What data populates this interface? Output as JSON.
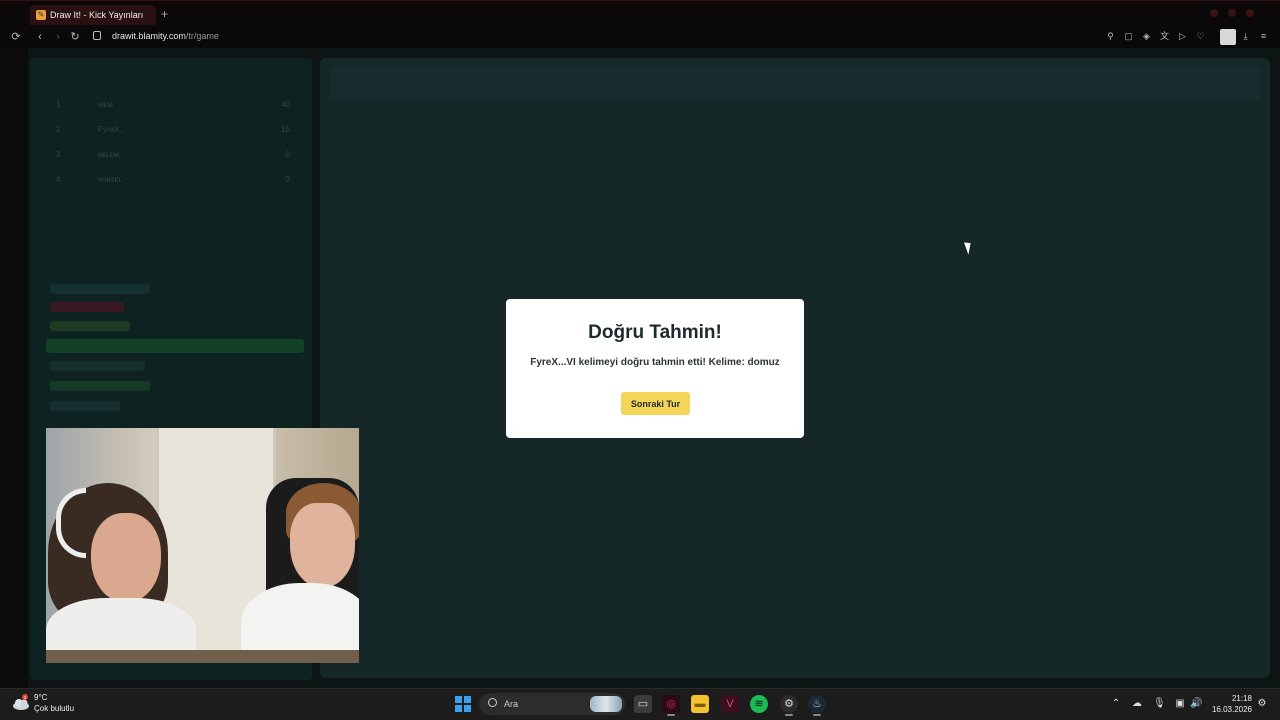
{
  "browser": {
    "tab_title": "Draw It! - Kick Yayınları",
    "new_tab_symbol": "+",
    "url_domain": "drawit.blamity.com",
    "url_path": "/tr/game"
  },
  "leaderboard": [
    {
      "rank": "1",
      "name": "ᴍᴇᴍ",
      "score": "40"
    },
    {
      "rank": "2",
      "name": "FyreX...",
      "score": "15"
    },
    {
      "rank": "3",
      "name": "ʙᴇʟᴇᴍ",
      "score": "0"
    },
    {
      "rank": "4",
      "name": "ʏᴜᴋsᴇʟ",
      "score": "0"
    }
  ],
  "modal": {
    "title": "Doğru Tahmin!",
    "message": "FyreX...VI kelimeyi doğru tahmin etti! Kelime: domuz",
    "button_label": "Sonraki Tur"
  },
  "taskbar": {
    "weather_temp": "9°C",
    "weather_desc": "Çok bulutlu",
    "weather_badge": "1",
    "search_placeholder": "Ara",
    "time": "21:18",
    "date": "16.03.2026"
  },
  "colors": {
    "accent_yellow": "#f5d45a",
    "canvas_bg": "#152727",
    "sidebar_bg": "#0f2222"
  }
}
